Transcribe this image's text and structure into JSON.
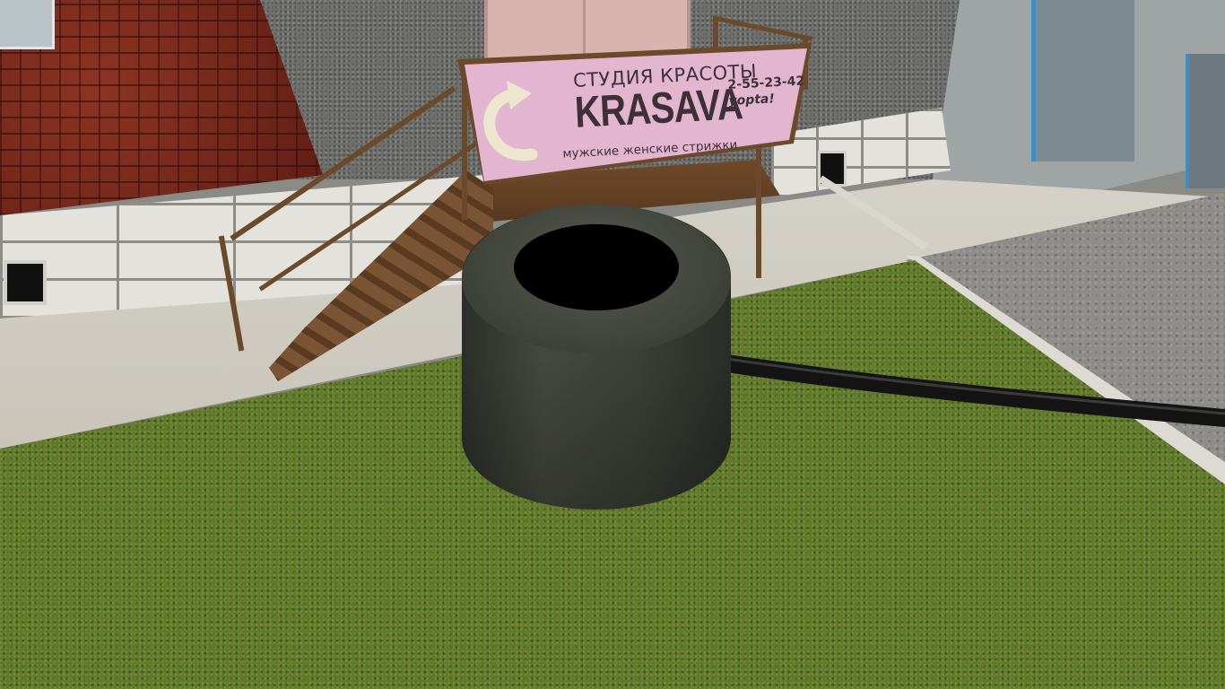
{
  "scene": {
    "sign": {
      "title": "СТУДИЯ КРАСОТЫ",
      "brand": "KRASAVA",
      "phone": "2-55-23-42",
      "slogan": "yopta!",
      "subtitle": "мужские женские стрижки",
      "colors": {
        "background": "#e2b6cf",
        "text": "#3d3036",
        "arrow": "#ece6cf"
      }
    },
    "objects": [
      "brick-wall",
      "stucco-wall",
      "pink-door",
      "right-building",
      "metal-stairs",
      "beauty-salon-sign",
      "tire",
      "hose",
      "sidewalk",
      "road",
      "grass"
    ],
    "colors": {
      "tire": "#3c3f37",
      "grass": "#5f7a2c",
      "brick": "#7a2a1e",
      "rust": "#6b4a2c"
    }
  }
}
